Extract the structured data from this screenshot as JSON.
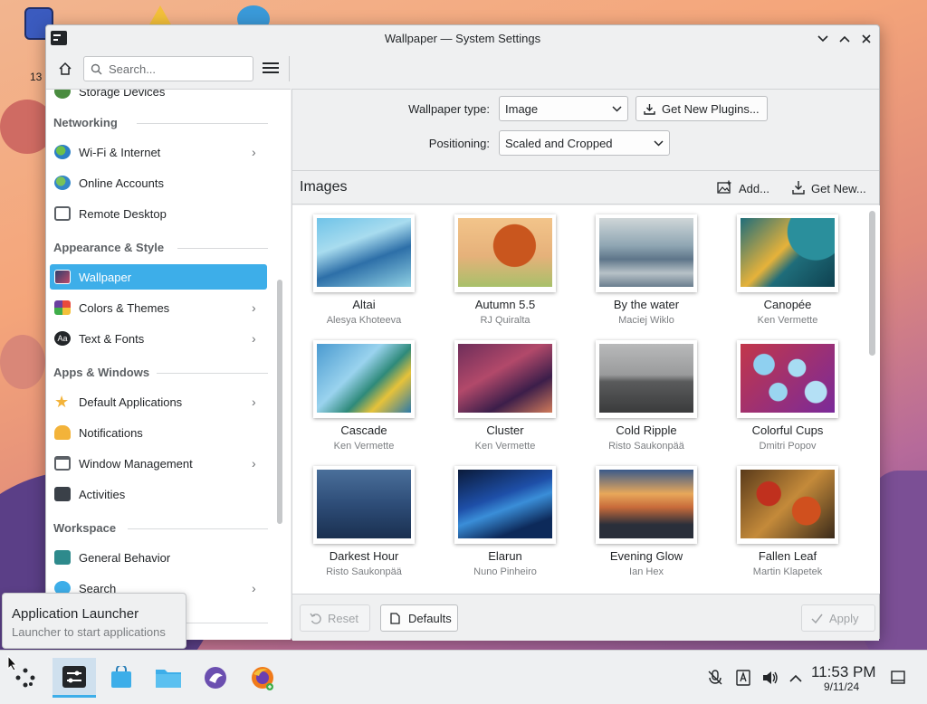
{
  "desktop": {
    "icon_label": "13"
  },
  "window": {
    "title": "Wallpaper — System Settings"
  },
  "toolbar": {
    "search_placeholder": "Search..."
  },
  "sidebar": {
    "partial_item": "Storage Devices",
    "categories": {
      "networking": "Networking",
      "appearance": "Appearance & Style",
      "apps": "Apps & Windows",
      "workspace": "Workspace"
    },
    "items": {
      "wifi": "Wi-Fi & Internet",
      "online_accounts": "Online Accounts",
      "remote_desktop": "Remote Desktop",
      "wallpaper": "Wallpaper",
      "colors_themes": "Colors & Themes",
      "text_fonts": "Text & Fonts",
      "default_apps": "Default Applications",
      "notifications": "Notifications",
      "window_management": "Window Management",
      "activities": "Activities",
      "general_behavior": "General Behavior",
      "search": "Search"
    }
  },
  "main": {
    "wallpaper_type_label": "Wallpaper type:",
    "wallpaper_type_value": "Image",
    "get_plugins": "Get New Plugins...",
    "positioning_label": "Positioning:",
    "positioning_value": "Scaled and Cropped",
    "images_title": "Images",
    "add_label": "Add...",
    "get_new_label": "Get New...",
    "wallpapers": [
      {
        "name": "Altai",
        "author": "Alesya Khoteeva"
      },
      {
        "name": "Autumn 5.5",
        "author": "RJ Quiralta"
      },
      {
        "name": "By the water",
        "author": "Maciej Wiklo"
      },
      {
        "name": "Canopée",
        "author": "Ken Vermette"
      },
      {
        "name": "Cascade",
        "author": "Ken Vermette"
      },
      {
        "name": "Cluster",
        "author": "Ken Vermette"
      },
      {
        "name": "Cold Ripple",
        "author": "Risto Saukonpää"
      },
      {
        "name": "Colorful Cups",
        "author": "Dmitri Popov"
      },
      {
        "name": "Darkest Hour",
        "author": "Risto Saukonpää"
      },
      {
        "name": "Elarun",
        "author": "Nuno Pinheiro"
      },
      {
        "name": "Evening Glow",
        "author": "Ian Hex"
      },
      {
        "name": "Fallen Leaf",
        "author": "Martin Klapetek"
      }
    ],
    "reset_label": "Reset",
    "defaults_label": "Defaults",
    "apply_label": "Apply"
  },
  "tooltip": {
    "title": "Application Launcher",
    "subtitle": "Launcher to start applications"
  },
  "taskbar": {
    "time": "11:53 PM",
    "date": "9/11/24"
  },
  "colors": {
    "accent": "#3daee9",
    "window_bg": "#eff0f1",
    "sidebar_bg": "#ffffff"
  }
}
